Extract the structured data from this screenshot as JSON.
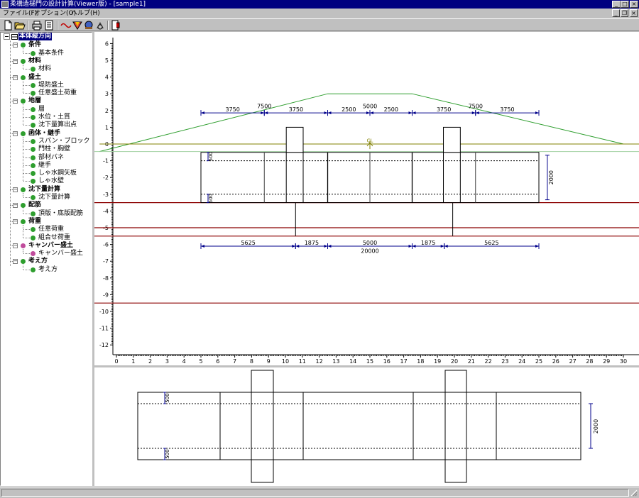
{
  "window": {
    "title": "柔構造樋門の設計計算(Viewer版) - [sample1]",
    "controls": [
      "_",
      "□",
      "×"
    ],
    "mdi_controls": [
      "_",
      "❐",
      "×"
    ]
  },
  "menu": {
    "items": [
      "ファイル(F)",
      "オプション(O)",
      "ヘルプ(H)"
    ]
  },
  "toolbar": {
    "icons": [
      "new-file-icon",
      "open-folder-icon",
      "print-icon",
      "calculator-icon",
      "settlement-icon",
      "structure-icon",
      "earth-icon",
      "report-icon",
      "exit-icon"
    ]
  },
  "tree": {
    "root": "本体縦方向",
    "groups": [
      {
        "label": "条件",
        "children": [
          "基本条件"
        ]
      },
      {
        "label": "材料",
        "children": [
          "材料"
        ]
      },
      {
        "label": "盛土",
        "children": [
          "堤防盛土",
          "任意盛土荷重"
        ]
      },
      {
        "label": "地層",
        "children": [
          "層",
          "水位・土質",
          "沈下量算出点"
        ]
      },
      {
        "label": "函体・継手",
        "children": [
          "スパン・ブロック",
          "門柱・胸壁",
          "部材バネ",
          "継手",
          "しゃ水鋼矢板",
          "しゃ水壁"
        ]
      },
      {
        "label": "沈下量計算",
        "children": [
          "沈下量計算"
        ]
      },
      {
        "label": "配筋",
        "children": [
          "頂版・底版配筋"
        ]
      },
      {
        "label": "荷重",
        "children": [
          "任意荷重",
          "組合せ荷重"
        ]
      },
      {
        "label": "キャンバー盛土",
        "children": [
          "キャンバー盛土"
        ],
        "pink": true
      },
      {
        "label": "考え方",
        "children": [
          "考え方"
        ]
      }
    ]
  },
  "drawing": {
    "colors": {
      "embankment": "#2e9e2e",
      "ground": "#808000",
      "layer": "#8b0000",
      "dimension": "#00008b",
      "structure": "#000000"
    },
    "y_axis_ticks": [
      "6",
      "5",
      "4",
      "3",
      "2",
      "1",
      "0",
      "-1",
      "-2",
      "-3",
      "-4",
      "-5",
      "-6",
      "-7",
      "-8",
      "-9",
      "-10",
      "-11",
      "-12"
    ],
    "x_axis_ticks": [
      "0",
      "1",
      "2",
      "3",
      "4",
      "5",
      "6",
      "7",
      "8",
      "9",
      "10",
      "11",
      "12",
      "13",
      "14",
      "15",
      "16",
      "17",
      "18",
      "19",
      "20",
      "21",
      "22",
      "23",
      "24",
      "25",
      "26",
      "27",
      "28",
      "29",
      "30"
    ],
    "embankment_dims_top": [
      "7500",
      "5000",
      "7500"
    ],
    "embankment_dims_bottom": [
      "3750",
      "3750",
      "2500",
      "2500",
      "3750",
      "3750"
    ],
    "box_dims_bottom": [
      "5625",
      "1875",
      "5000",
      "1875",
      "5625"
    ],
    "box_total": "20000",
    "box_height": "2000",
    "slab_thickness": [
      "500",
      "500"
    ],
    "plan_slab": [
      "500",
      "500"
    ],
    "plan_height": "2000",
    "cl_label": "CL"
  }
}
